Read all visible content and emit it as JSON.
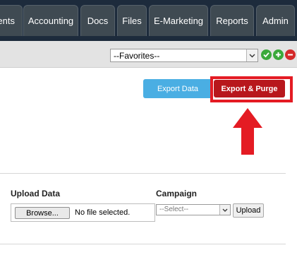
{
  "nav": {
    "tabs": [
      {
        "label": "ents"
      },
      {
        "label": "Accounting"
      },
      {
        "label": "Docs"
      },
      {
        "label": "Files"
      },
      {
        "label": "E-Marketing"
      },
      {
        "label": "Reports"
      },
      {
        "label": "Admin"
      }
    ]
  },
  "toolbar": {
    "favorites_value": "--Favorites--",
    "icons": [
      "check-icon",
      "add-icon",
      "remove-icon"
    ]
  },
  "actions": {
    "export_label": "Export Data",
    "purge_label": "Export & Purge"
  },
  "upload": {
    "title": "Upload Data",
    "browse_label": "Browse...",
    "file_status": "No file selected."
  },
  "campaign": {
    "title": "Campaign",
    "select_value": "--Select--",
    "upload_label": "Upload"
  },
  "colors": {
    "navbar": "#1d2b3c",
    "tab": "#3f4a52",
    "export_button": "#4aaee3",
    "purge_button": "#b8171c",
    "highlight": "#e41b23",
    "check": "#3aa93a",
    "add": "#3aa93a",
    "remove": "#d42a2a"
  }
}
